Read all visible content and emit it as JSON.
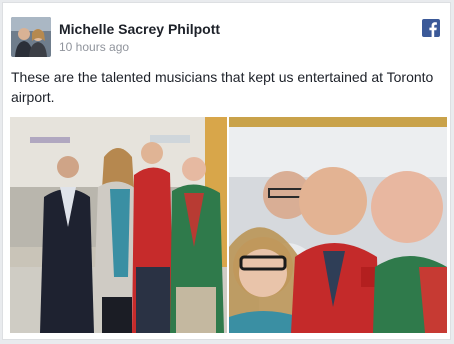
{
  "post": {
    "author": "Michelle Sacrey Philpott",
    "timestamp": "10 hours ago",
    "message": "These are the talented musicians that kept us entertained at Toronto airport."
  },
  "icons": {
    "brand": "facebook-icon",
    "avatar": "profile-photo"
  },
  "photos": [
    {
      "name": "airport-group-photo"
    },
    {
      "name": "selfie-group-photo"
    }
  ],
  "colors": {
    "brand": "#3b5998",
    "author_text": "#1d2129",
    "meta_text": "#90949c",
    "background": "#e9ebee"
  }
}
